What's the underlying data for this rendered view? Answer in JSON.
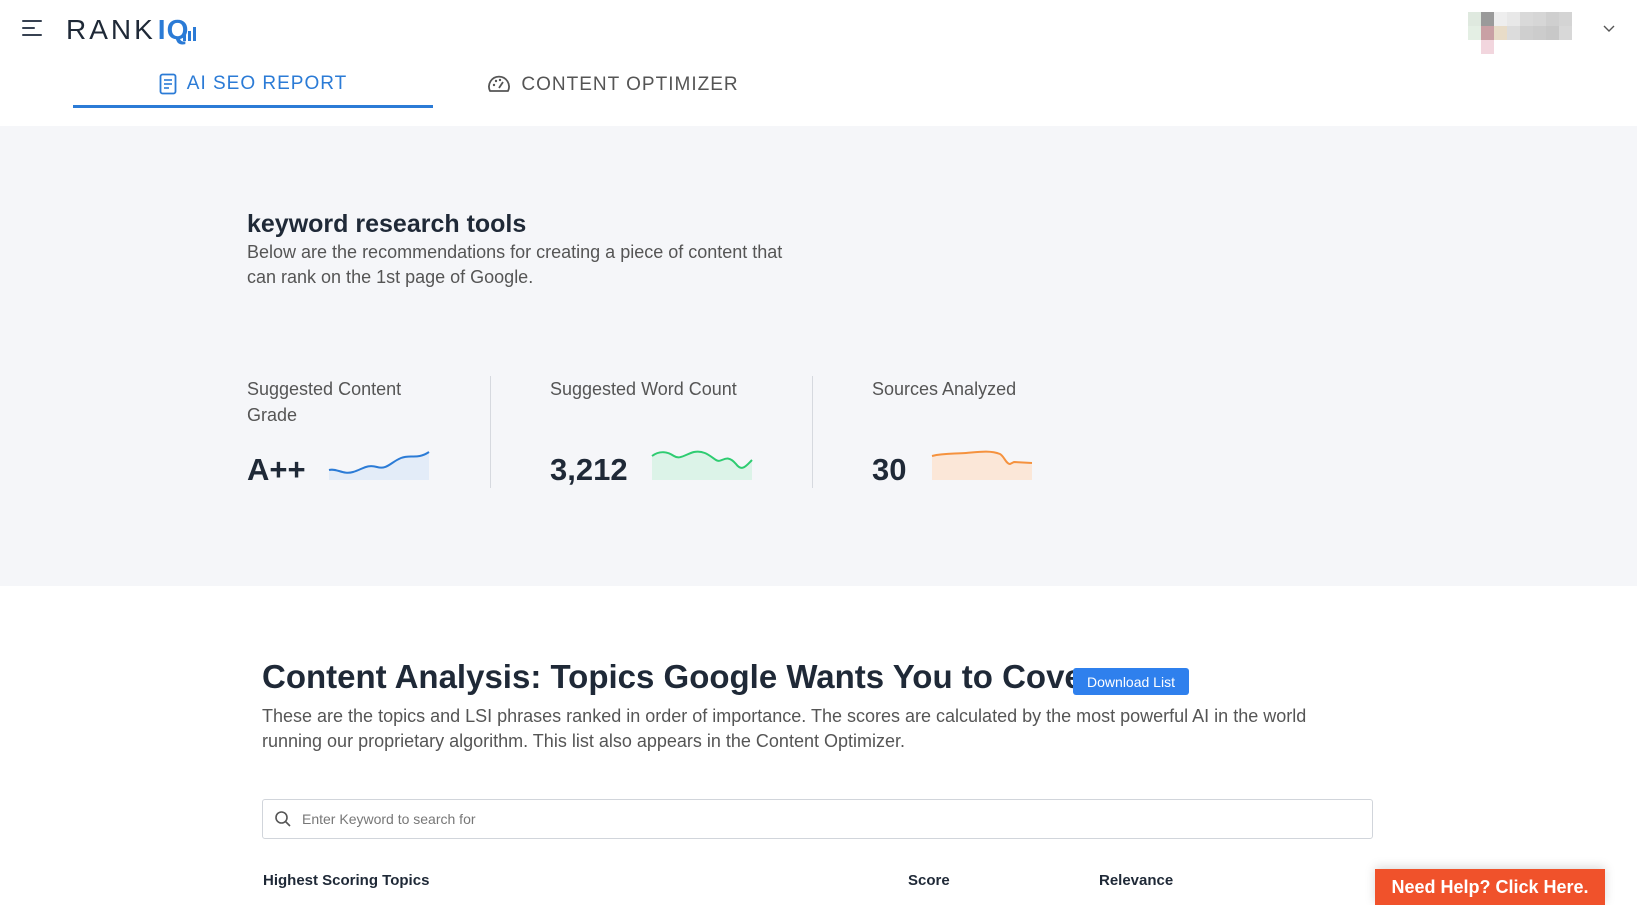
{
  "header": {
    "logo_text": "RANK",
    "logo_accent": "IQ",
    "tabs": [
      {
        "label": "AI SEO REPORT",
        "active": true,
        "icon": "report-icon"
      },
      {
        "label": "CONTENT OPTIMIZER",
        "active": false,
        "icon": "speedometer-icon"
      }
    ]
  },
  "summary": {
    "keyword": "keyword research tools",
    "description": "Below are the recommendations for creating a piece of content that can rank on the 1st page of Google.",
    "metrics": [
      {
        "label": "Suggested Content Grade",
        "value": "A++",
        "color": "#2b7bd6"
      },
      {
        "label": "Suggested Word Count",
        "value": "3,212",
        "color": "#2ecc71"
      },
      {
        "label": "Sources Analyzed",
        "value": "30",
        "color": "#f5923e"
      }
    ]
  },
  "analysis": {
    "title": "Content Analysis: Topics Google Wants You to Cover",
    "download_label": "Download List",
    "description": "These are the topics and LSI phrases ranked in order of importance. The scores are calculated by the most powerful AI in the world running our proprietary algorithm. This list also appears in the Content Optimizer.",
    "search_placeholder": "Enter Keyword to search for",
    "columns": [
      "Highest Scoring Topics",
      "Score",
      "Relevance"
    ]
  },
  "help_label": "Need Help? Click Here.",
  "colors": {
    "accent": "#2b7bd6",
    "help": "#f0522b",
    "button": "#2f80ed"
  }
}
